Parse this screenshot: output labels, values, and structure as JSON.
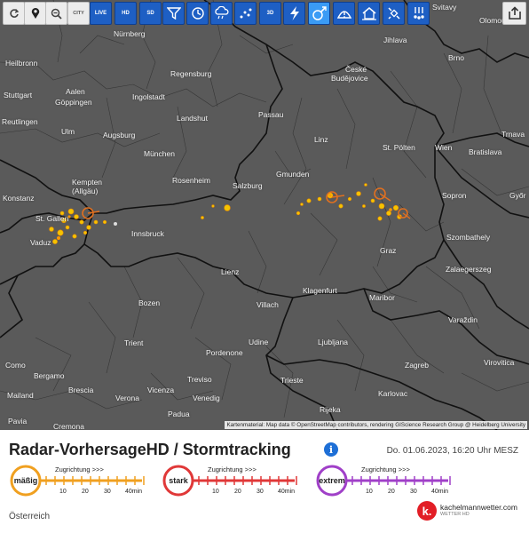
{
  "toolbar": {
    "buttons": [
      {
        "id": "reload",
        "icon": "reload-icon"
      },
      {
        "id": "location",
        "icon": "location-pin-icon"
      },
      {
        "id": "zoom",
        "icon": "zoom-out-icon"
      },
      {
        "id": "city",
        "icon": "city-labels-icon",
        "label": "CITY"
      },
      {
        "id": "live",
        "icon": "live-radar-icon",
        "label": "LIVE"
      },
      {
        "id": "hd",
        "icon": "radar-hd-icon",
        "label": "HD"
      },
      {
        "id": "sd",
        "icon": "radar-sd-icon",
        "label": "SD"
      },
      {
        "id": "funnel",
        "icon": "funnel-icon"
      },
      {
        "id": "clock",
        "icon": "clock-icon"
      },
      {
        "id": "rain",
        "icon": "rain-cloud-icon"
      },
      {
        "id": "dots",
        "icon": "precip-dots-icon"
      },
      {
        "id": "3d",
        "icon": "3d-icon",
        "label": "3D"
      },
      {
        "id": "lightning",
        "icon": "lightning-icon"
      },
      {
        "id": "stormtrack",
        "icon": "storm-track-icon"
      },
      {
        "id": "warning",
        "icon": "warning-icon"
      },
      {
        "id": "home",
        "icon": "home-storm-icon"
      },
      {
        "id": "satellite",
        "icon": "satellite-icon"
      },
      {
        "id": "hail",
        "icon": "hail-icon"
      }
    ],
    "share_icon": "share-icon"
  },
  "map": {
    "attribution": "Kartenmaterial: Map data © OpenStreetMap contributors, rendering GIScience Research Group @ Heidelberg University",
    "cities": [
      {
        "name": "Nürnberg"
      },
      {
        "name": "Svitavy"
      },
      {
        "name": "Olomouc"
      },
      {
        "name": "Jihlava"
      },
      {
        "name": "Heilbronn"
      },
      {
        "name": "Regensburg"
      },
      {
        "name": "Brno"
      },
      {
        "name": "České"
      },
      {
        "name": "Budějovice"
      },
      {
        "name": "Stuttgart"
      },
      {
        "name": "Aalen"
      },
      {
        "name": "Göppingen"
      },
      {
        "name": "Ingolstadt"
      },
      {
        "name": "Reutlingen"
      },
      {
        "name": "Landshut"
      },
      {
        "name": "Passau"
      },
      {
        "name": "Ulm"
      },
      {
        "name": "Augsburg"
      },
      {
        "name": "Trnava"
      },
      {
        "name": "Linz"
      },
      {
        "name": "St. Pölten"
      },
      {
        "name": "Wien"
      },
      {
        "name": "Bratislava"
      },
      {
        "name": "München"
      },
      {
        "name": "Kempten"
      },
      {
        "name": "(Allgäu)"
      },
      {
        "name": "Gmunden"
      },
      {
        "name": "Rosenheim"
      },
      {
        "name": "Salzburg"
      },
      {
        "name": "Konstanz"
      },
      {
        "name": "Sopron"
      },
      {
        "name": "Győr"
      },
      {
        "name": "St. Gallen"
      },
      {
        "name": "Vaduz"
      },
      {
        "name": "Innsbruck"
      },
      {
        "name": "Szombathely"
      },
      {
        "name": "Graz"
      },
      {
        "name": "Lienz"
      },
      {
        "name": "Zalaegerszeg"
      },
      {
        "name": "Klagenfurt"
      },
      {
        "name": "Maribor"
      },
      {
        "name": "Bozen"
      },
      {
        "name": "Villach"
      },
      {
        "name": "Varaždin"
      },
      {
        "name": "Trient"
      },
      {
        "name": "Udine"
      },
      {
        "name": "Ljubljana"
      },
      {
        "name": "Pordenone"
      },
      {
        "name": "Como"
      },
      {
        "name": "Zagreb"
      },
      {
        "name": "Virovitica"
      },
      {
        "name": "Bergamo"
      },
      {
        "name": "Trieste"
      },
      {
        "name": "Brescia"
      },
      {
        "name": "Vicenza"
      },
      {
        "name": "Treviso"
      },
      {
        "name": "Karlovac"
      },
      {
        "name": "Mailand"
      },
      {
        "name": "Verona"
      },
      {
        "name": "Venedig"
      },
      {
        "name": "Padua"
      },
      {
        "name": "Rijeka"
      },
      {
        "name": "Pavia"
      },
      {
        "name": "Cremona"
      }
    ],
    "colors": {
      "background": "#5a5a5a",
      "borders": "#1a1a1a",
      "cells": "#f5c400",
      "cells_core": "#e88a00",
      "track_circle": "#e07020"
    }
  },
  "legend": {
    "title": "Radar-VorhersageHD / Stormtracking",
    "info_icon": "info-icon",
    "date": "Do. 01.06.2023, 16:20 Uhr MESZ",
    "scales": [
      {
        "label": "mäßig",
        "color": "#f0a020",
        "direction": "Zugrichtung >>>",
        "ticks": [
          "10",
          "20",
          "30",
          "40min"
        ]
      },
      {
        "label": "stark",
        "color": "#e03838",
        "direction": "Zugrichtung >>>",
        "ticks": [
          "10",
          "20",
          "30",
          "40min"
        ]
      },
      {
        "label": "extrem",
        "color": "#a040c8",
        "direction": "Zugrichtung >>>",
        "ticks": [
          "10",
          "20",
          "30",
          "40min"
        ]
      }
    ],
    "region": "Österreich",
    "brand": {
      "name": "kachelmannwetter.com",
      "sub": "WETTER HD",
      "mark": "k."
    }
  }
}
